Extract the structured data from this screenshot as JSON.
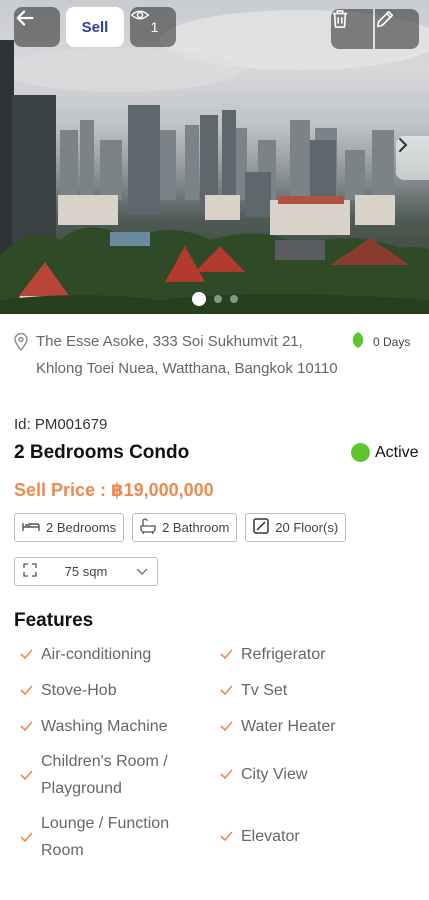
{
  "header": {
    "sell_label": "Sell",
    "view_count": "1",
    "icons": {
      "back": "arrow-left-icon",
      "views": "eye-icon",
      "delete": "trash-icon",
      "edit": "pencil-icon",
      "next": "chevron-right-icon"
    }
  },
  "gallery": {
    "slide_count": 3,
    "active_slide": 1
  },
  "listing": {
    "address": "The Esse Asoke, 333 Soi Sukhumvit 21, Khlong Toei Nuea, Watthana, Bangkok 10110",
    "days_listed": "0 Days",
    "id_text": "Id: PM001679",
    "title": "2 Bedrooms Condo",
    "status": "Active",
    "status_color": "#5cc72b",
    "price": "Sell Price : ฿19,000,000",
    "price_color": "#ef8a4e",
    "chips": {
      "bedrooms": "2 Bedrooms",
      "bathroom": "2 Bathroom",
      "floor": "20 Floor(s)"
    },
    "area": "75 sqm"
  },
  "features": {
    "title": "Features",
    "items": [
      "Air-conditioning",
      "Refrigerator",
      "Stove-Hob",
      "Tv Set",
      "Washing Machine",
      "Water Heater",
      "Children's Room / Playground",
      "City View",
      "Lounge / Function Room",
      "Elevator"
    ],
    "check_color": "#ef8a4e"
  }
}
